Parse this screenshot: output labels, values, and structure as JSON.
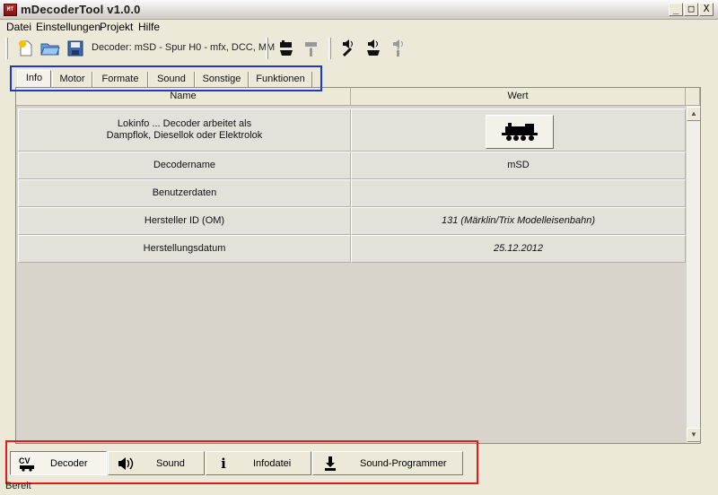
{
  "window": {
    "title": "mDecoderTool v1.0.0",
    "app_icon_text": "MT",
    "minimize": "_",
    "maximize": "□",
    "close": "X"
  },
  "menu": [
    "Datei",
    "Einstellungen",
    "Projekt",
    "Hilfe"
  ],
  "toolbar": {
    "decoder_label": "Decoder: mSD - Spur H0 - mfx, DCC, MM",
    "icons": [
      "new-file-icon",
      "open-folder-icon",
      "save-disk-icon",
      "loco-write-icon",
      "loco-info-icon",
      "sound-tool-icon",
      "sound-write-icon",
      "sound-info-icon"
    ]
  },
  "tabs": [
    "Info",
    "Motor",
    "Formate",
    "Sound",
    "Sonstige",
    "Funktionen"
  ],
  "table": {
    "headers": [
      "Name",
      "Wert"
    ],
    "rows": [
      {
        "name": "Lokinfo ... Decoder arbeitet als\nDampflok, Diesellok oder Elektrolok",
        "value": ""
      },
      {
        "name": "Decodername",
        "value": "mSD"
      },
      {
        "name": "Benutzerdaten",
        "value": ""
      },
      {
        "name": "Hersteller ID (OM)",
        "value": "131 (Märklin/Trix Modelleisenbahn)"
      },
      {
        "name": "Herstellungsdatum",
        "value": "25.12.2012"
      }
    ]
  },
  "bottom_buttons": [
    {
      "label": "Decoder",
      "icon_text": "CV",
      "icon": "cv-loco-icon"
    },
    {
      "label": "Sound",
      "icon_text": "◀))",
      "icon": "speaker-icon"
    },
    {
      "label": "Infodatei",
      "icon_text": "i",
      "icon": "info-icon"
    },
    {
      "label": "Sound-Programmer",
      "icon_text": "",
      "icon": "download-icon"
    }
  ],
  "status": "Bereit",
  "colors": {
    "highlight_tabs": "#1f36d3",
    "highlight_bottom": "#e51b1b"
  }
}
